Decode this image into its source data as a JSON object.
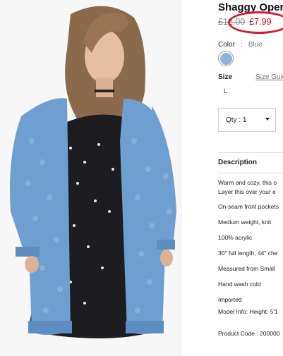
{
  "product": {
    "title": "Shaggy Oper",
    "old_price": "£12.00",
    "new_price": "£7.99",
    "color_label": "Color",
    "color_separator": ":",
    "color_value": "Blue",
    "swatch_color": "#8fb6d9",
    "size_label": "Size",
    "size_guide": "Size Guid",
    "size_option": "L",
    "qty_label": "Qty : 1"
  },
  "description": {
    "heading": "Description",
    "lines": [
      "Warm and cozy, this o",
      "Layer this over your e",
      "On-seam front pockets",
      "Medium weight, knit",
      "100% acrylic",
      "30\" full length, 44\" che",
      "Measured from Small",
      "Hand wash cold",
      "Imported",
      "Model Info: Height: 5'1",
      "Product Code : 200000"
    ]
  },
  "colors": {
    "sale_red": "#d0021b",
    "annotation_circle": "#d9182b",
    "cardigan_blue": "#6f9fd0"
  }
}
